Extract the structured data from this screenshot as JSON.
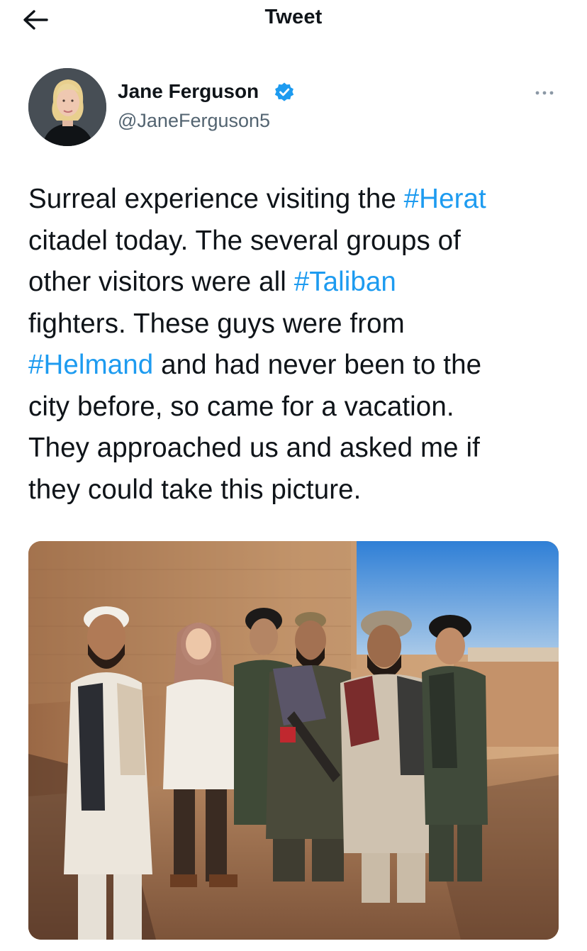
{
  "header": {
    "title": "Tweet",
    "back_icon": "arrow-left-icon"
  },
  "author": {
    "name": "Jane Ferguson",
    "handle": "@JaneFerguson5",
    "verified": true,
    "verified_color": "#1d9bf0"
  },
  "tweet": {
    "lines": [
      [
        {
          "t": "Surreal experience visiting the "
        },
        {
          "tag": "#Herat"
        }
      ],
      [
        {
          "t": "citadel today. The several groups of"
        }
      ],
      [
        {
          "t": "other visitors were all "
        },
        {
          "tag": "#Taliban"
        }
      ],
      [
        {
          "t": "fighters. These guys were from"
        }
      ],
      [
        {
          "tag": "#Helmand"
        },
        {
          "t": " and had never been to the"
        }
      ],
      [
        {
          "t": "city before, so came for a vacation."
        }
      ],
      [
        {
          "t": "They approached us and asked me if"
        }
      ],
      [
        {
          "t": "they could take this picture."
        }
      ]
    ],
    "hashtag_color": "#1d9bf0"
  },
  "media": {
    "icon": "photo-icon"
  },
  "more_icon": "more-horizontal-icon"
}
